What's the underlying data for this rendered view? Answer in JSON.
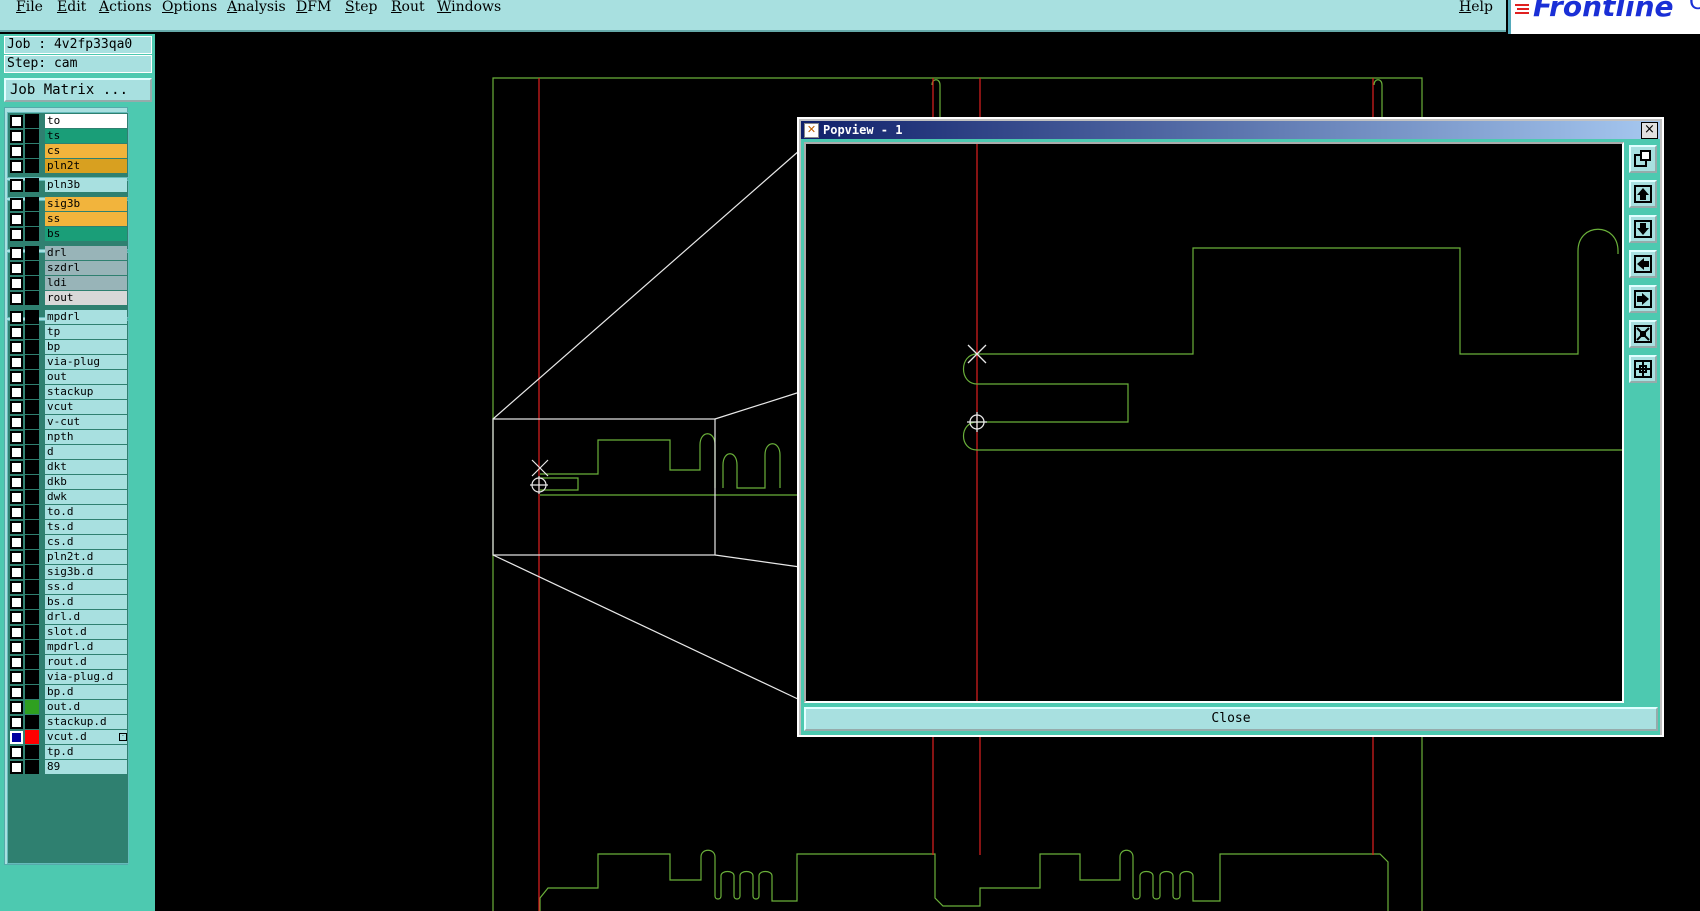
{
  "menubar": {
    "items": [
      "File",
      "Edit",
      "Actions",
      "Options",
      "Analysis",
      "DFM",
      "Step",
      "Rout",
      "Windows"
    ],
    "help": "Help"
  },
  "logo": {
    "text": "Frontline",
    "extra": "C"
  },
  "job_info": {
    "job": "Job : 4v2fp33qa0",
    "step": "Step: cam"
  },
  "job_matrix_button": "Job Matrix ...",
  "layers": [
    {
      "name": "to",
      "color": "#ffffff"
    },
    {
      "name": "ts",
      "color": "#1a9e78"
    },
    {
      "name": "cs",
      "color": "#f2b43c"
    },
    {
      "name": "pln2t",
      "color": "#d8a020"
    },
    {
      "name": "pln3b",
      "color": "#a8e0e0"
    },
    {
      "name": "sig3b",
      "color": "#f2b43c"
    },
    {
      "name": "ss",
      "color": "#f2b43c"
    },
    {
      "name": "bs",
      "color": "#1a9e78"
    },
    {
      "name": "drl",
      "color": "#98b4b8"
    },
    {
      "name": "szdrl",
      "color": "#98b4b8"
    },
    {
      "name": "ldi",
      "color": "#98b4b8"
    },
    {
      "name": "rout",
      "color": "#d8d8d8"
    },
    {
      "name": "mpdrl",
      "color": "#a8e0e0"
    },
    {
      "name": "tp",
      "color": "#a8e0e0"
    },
    {
      "name": "bp",
      "color": "#a8e0e0"
    },
    {
      "name": "via-plug",
      "color": "#a8e0e0"
    },
    {
      "name": "out",
      "color": "#a8e0e0"
    },
    {
      "name": "stackup",
      "color": "#a8e0e0"
    },
    {
      "name": "vcut",
      "color": "#a8e0e0"
    },
    {
      "name": "v-cut",
      "color": "#a8e0e0"
    },
    {
      "name": "npth",
      "color": "#a8e0e0"
    },
    {
      "name": "d",
      "color": "#a8e0e0"
    },
    {
      "name": "dkt",
      "color": "#a8e0e0"
    },
    {
      "name": "dkb",
      "color": "#a8e0e0"
    },
    {
      "name": "dwk",
      "color": "#a8e0e0"
    },
    {
      "name": "to.d",
      "color": "#a8e0e0"
    },
    {
      "name": "ts.d",
      "color": "#a8e0e0"
    },
    {
      "name": "cs.d",
      "color": "#a8e0e0"
    },
    {
      "name": "pln2t.d",
      "color": "#a8e0e0"
    },
    {
      "name": "sig3b.d",
      "color": "#a8e0e0"
    },
    {
      "name": "ss.d",
      "color": "#a8e0e0"
    },
    {
      "name": "bs.d",
      "color": "#a8e0e0"
    },
    {
      "name": "drl.d",
      "color": "#a8e0e0"
    },
    {
      "name": "slot.d",
      "color": "#a8e0e0"
    },
    {
      "name": "mpdrl.d",
      "color": "#a8e0e0"
    },
    {
      "name": "rout.d",
      "color": "#a8e0e0"
    },
    {
      "name": "via-plug.d",
      "color": "#a8e0e0"
    },
    {
      "name": "bp.d",
      "color": "#a8e0e0"
    },
    {
      "name": "out.d",
      "color": "#a8e0e0",
      "swatch": "#2fa020"
    },
    {
      "name": "stackup.d",
      "color": "#a8e0e0"
    },
    {
      "name": "vcut.d",
      "color": "#a8e0e0",
      "swatch": "#ff0000",
      "checked": true
    },
    {
      "name": "tp.d",
      "color": "#a8e0e0"
    },
    {
      "name": "89",
      "color": "#a8e0e0"
    }
  ],
  "popview": {
    "title": "Popview - 1",
    "close_x": "×",
    "close_button": "Close",
    "tools": [
      "zoom-home-icon",
      "pan-up-icon",
      "pan-down-icon",
      "pan-left-icon",
      "pan-right-icon",
      "zoom-fit-icon",
      "zoom-center-icon"
    ]
  },
  "colors": {
    "panel": "#a8e0e0",
    "teal": "#4dc9b0",
    "profile": "#6ab03a",
    "vcut_line": "#e02020"
  }
}
